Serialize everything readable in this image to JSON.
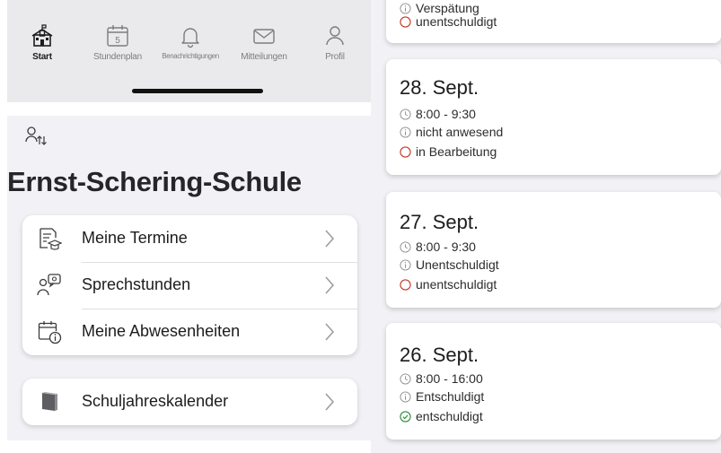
{
  "tabbar": {
    "tabs": [
      {
        "label": "Start",
        "icon": "school-icon",
        "active": true
      },
      {
        "label": "Stundenplan",
        "icon": "calendar-icon",
        "badge": "5"
      },
      {
        "label": "Benachrichtigungen",
        "icon": "bell-icon"
      },
      {
        "label": "Mitteilungen",
        "icon": "envelope-icon"
      },
      {
        "label": "Profil",
        "icon": "person-icon"
      }
    ]
  },
  "school": {
    "switch_icon": "person-switch-icon",
    "name": "Ernst-Schering-Schule"
  },
  "menu": {
    "items": [
      {
        "label": "Meine Termine",
        "icon": "document-graduation-icon"
      },
      {
        "label": "Sprechstunden",
        "icon": "consultation-icon"
      },
      {
        "label": "Meine Abwesenheiten",
        "icon": "calendar-info-icon"
      }
    ],
    "calendar_item": {
      "label": "Schuljahreskalender",
      "icon": "calendar-book-icon"
    }
  },
  "absences": {
    "partial_top": {
      "reason": "Verspätung",
      "status": "unentschuldigt",
      "status_color": "#c0392b"
    },
    "entries": [
      {
        "date": "28. Sept.",
        "time": "8:00 - 9:30",
        "reason": "nicht anwesend",
        "status": "in Bearbeitung",
        "status_color": "#c0392b"
      },
      {
        "date": "27. Sept.",
        "time": "8:00 - 9:30",
        "reason": "Unentschuldigt",
        "status": "unentschuldigt",
        "status_color": "#c0392b"
      },
      {
        "date": "26. Sept.",
        "time": "8:00 - 16:00",
        "reason": "Entschuldigt",
        "status": "entschuldigt",
        "status_color": "#2e8b3a"
      }
    ]
  }
}
